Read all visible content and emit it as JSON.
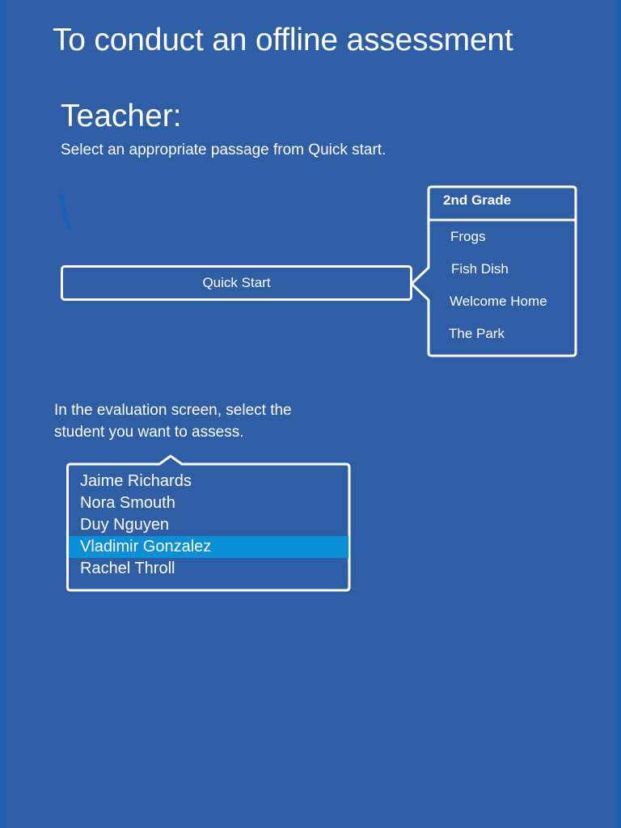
{
  "title": "To conduct an offline assessment",
  "teacher_section": {
    "heading": "Teacher:",
    "instruction": "Select an appropriate passage from Quick start.",
    "quick_start_label": "Quick Start"
  },
  "passage_menu": {
    "header": "2nd Grade",
    "items": [
      "Frogs",
      "Fish Dish",
      "Welcome Home",
      "The Park"
    ]
  },
  "evaluation_section": {
    "instruction": "In the evaluation screen, select the student you want to assess."
  },
  "students": {
    "items": [
      "Jaime Richards",
      "Nora Smouth",
      "Duy Nguyen",
      "Vladimir Gonzalez",
      "Rachel Throll"
    ],
    "selected": "Vladimir Gonzalez"
  },
  "colors": {
    "background": "#2e5fa6",
    "edge": "#1f60a8",
    "selection": "#0b8fd6",
    "text": "#ffffff"
  }
}
